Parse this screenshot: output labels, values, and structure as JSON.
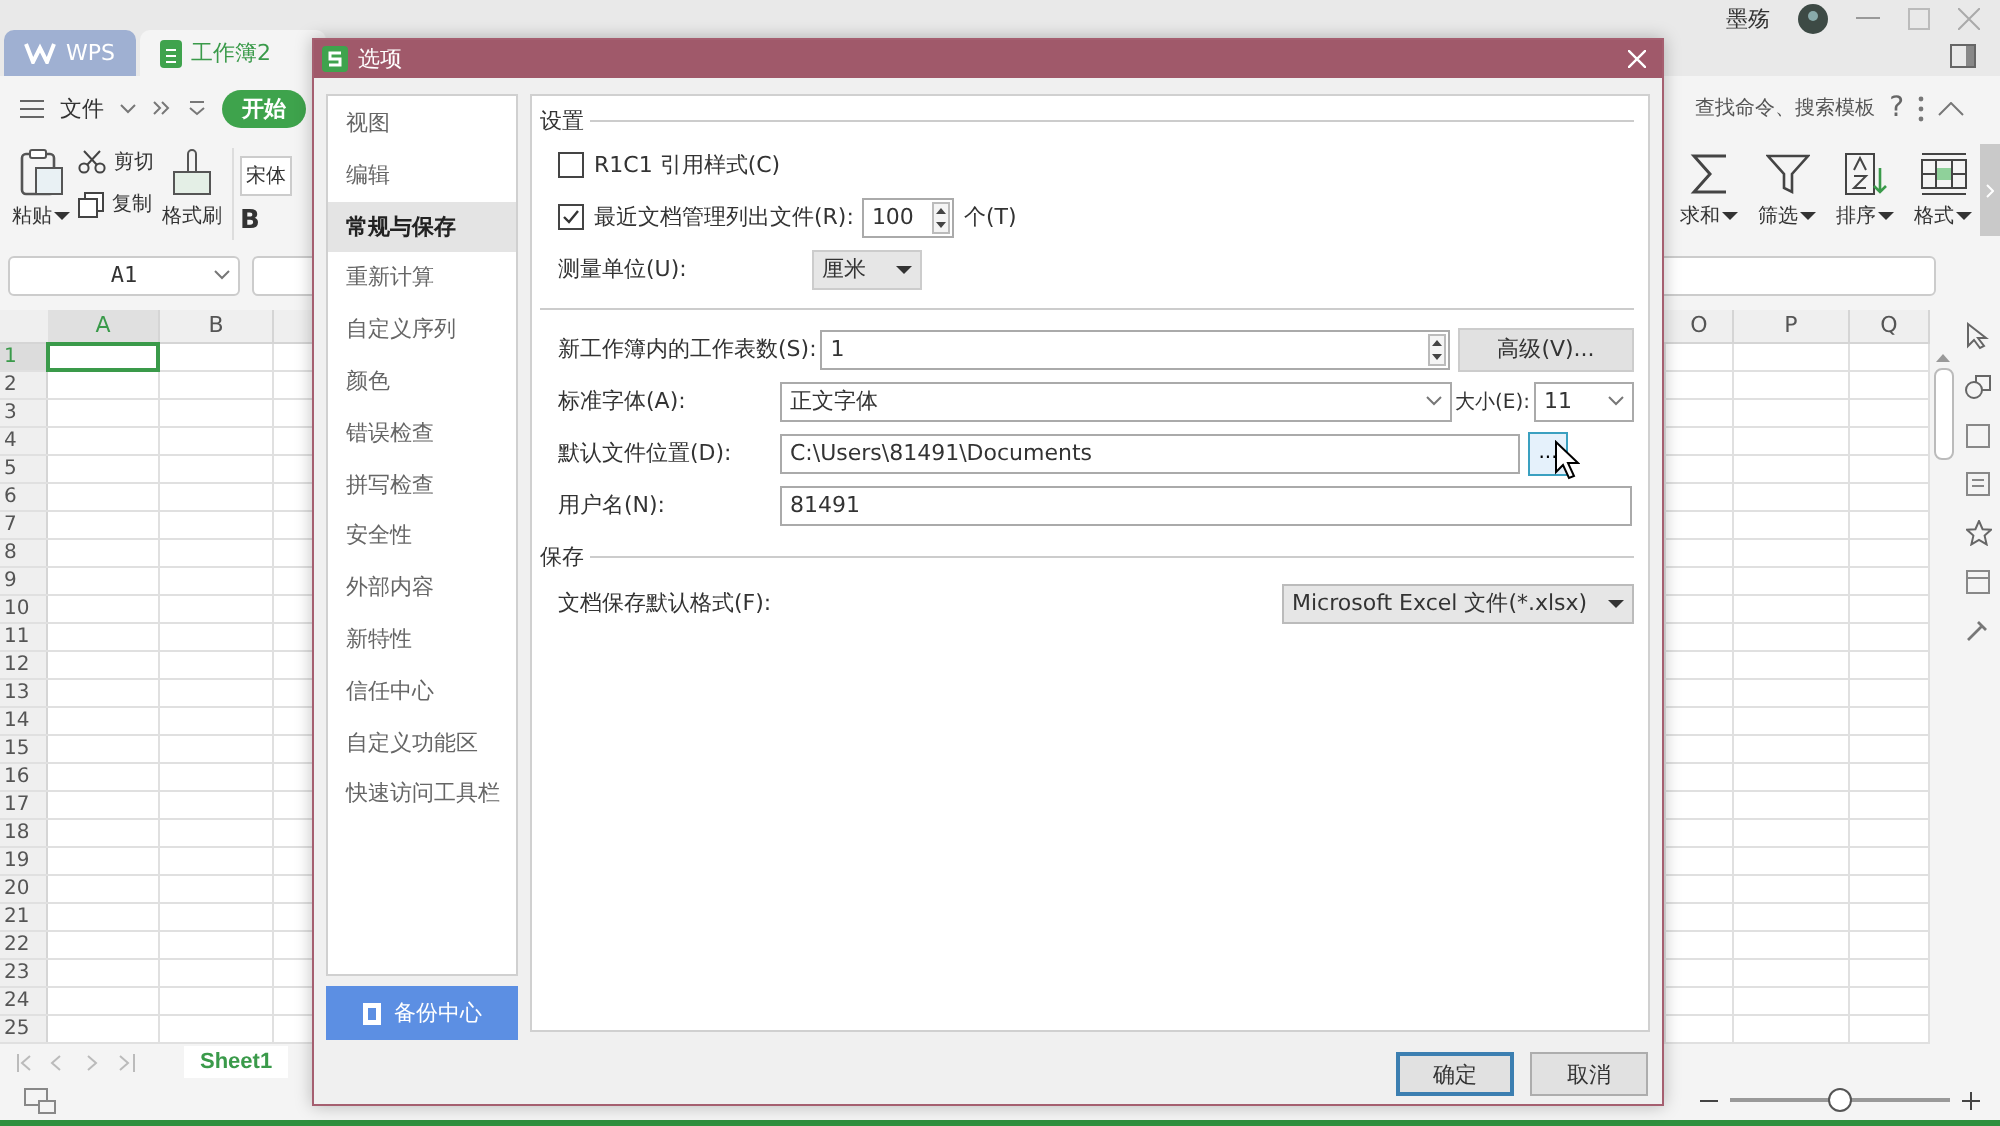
{
  "title_bar": {
    "tabs": [
      {
        "label": "WPS",
        "kind": "home",
        "selected": false
      },
      {
        "label": "工作簿2",
        "kind": "spreadsheet",
        "selected": true
      }
    ],
    "user_name": "墨殇"
  },
  "menu_bar": {
    "file": "文件",
    "tabs": [
      {
        "label": "开始",
        "selected": true
      }
    ],
    "search": "查找命令、搜索模板",
    "help": "?"
  },
  "ribbon": {
    "left": [
      {
        "label": "粘贴",
        "kind": "paste"
      },
      {
        "label": "剪切",
        "kind": "cut"
      },
      {
        "label": "复制",
        "kind": "copy"
      },
      {
        "label": "格式刷",
        "kind": "painter"
      }
    ],
    "font": "宋体",
    "bold": "B",
    "right": [
      {
        "label": "求和",
        "kind": "sum"
      },
      {
        "label": "筛选",
        "kind": "filter"
      },
      {
        "label": "排序",
        "kind": "sort"
      },
      {
        "label": "格式",
        "kind": "format"
      }
    ]
  },
  "name_box": "A1",
  "sheet": {
    "columns_left": [
      {
        "label": "A",
        "selected": true
      },
      {
        "label": "B",
        "selected": false
      }
    ],
    "columns_right": [
      {
        "label": "O",
        "selected": false
      },
      {
        "label": "P",
        "selected": false
      },
      {
        "label": "Q",
        "selected": false
      }
    ],
    "rows": [
      {
        "label": "1",
        "selected": true
      },
      {
        "label": "2",
        "selected": false
      },
      {
        "label": "3",
        "selected": false
      },
      {
        "label": "4",
        "selected": false
      },
      {
        "label": "5",
        "selected": false
      },
      {
        "label": "6",
        "selected": false
      },
      {
        "label": "7",
        "selected": false
      },
      {
        "label": "8",
        "selected": false
      },
      {
        "label": "9",
        "selected": false
      },
      {
        "label": "10",
        "selected": false
      },
      {
        "label": "11",
        "selected": false
      },
      {
        "label": "12",
        "selected": false
      },
      {
        "label": "13",
        "selected": false
      },
      {
        "label": "14",
        "selected": false
      },
      {
        "label": "15",
        "selected": false
      },
      {
        "label": "16",
        "selected": false
      },
      {
        "label": "17",
        "selected": false
      },
      {
        "label": "18",
        "selected": false
      },
      {
        "label": "19",
        "selected": false
      },
      {
        "label": "20",
        "selected": false
      },
      {
        "label": "21",
        "selected": false
      },
      {
        "label": "22",
        "selected": false
      },
      {
        "label": "23",
        "selected": false
      },
      {
        "label": "24",
        "selected": false
      },
      {
        "label": "25",
        "selected": false
      }
    ]
  },
  "sheet_tabs": [
    {
      "label": "Sheet1",
      "selected": true
    }
  ],
  "zoom": {
    "level": 0.5
  },
  "dialog": {
    "title": "选项",
    "nav": [
      {
        "label": "视图",
        "selected": false
      },
      {
        "label": "编辑",
        "selected": false
      },
      {
        "label": "常规与保存",
        "selected": true
      },
      {
        "label": "重新计算",
        "selected": false
      },
      {
        "label": "自定义序列",
        "selected": false
      },
      {
        "label": "颜色",
        "selected": false
      },
      {
        "label": "错误检查",
        "selected": false
      },
      {
        "label": "拼写检查",
        "selected": false
      },
      {
        "label": "安全性",
        "selected": false
      },
      {
        "label": "外部内容",
        "selected": false
      },
      {
        "label": "新特性",
        "selected": false
      },
      {
        "label": "信任中心",
        "selected": false
      },
      {
        "label": "自定义功能区",
        "selected": false
      },
      {
        "label": "快速访问工具栏",
        "selected": false
      }
    ],
    "backup_button": "备份中心",
    "settings": {
      "title": "设置",
      "r1c1": {
        "label": "R1C1 引用样式(C)",
        "checked": false
      },
      "recent": {
        "label": "最近文档管理列出文件(R):",
        "checked": true,
        "value": "100",
        "unit": "个(T)"
      },
      "unit": {
        "label": "测量单位(U):",
        "value": "厘米"
      },
      "sheet_count": {
        "label": "新工作簿内的工作表数(S):",
        "value": "1"
      },
      "advanced_button": "高级(V)...",
      "font": {
        "label": "标准字体(A):",
        "value": "正文字体"
      },
      "size": {
        "label": "大小(E):",
        "value": "11"
      },
      "location": {
        "label": "默认文件位置(D):",
        "value": "C:\\Users\\81491\\Documents",
        "browse": "..."
      },
      "user": {
        "label": "用户名(N):",
        "value": "81491"
      }
    },
    "save": {
      "title": "保存",
      "format": {
        "label": "文档保存默认格式(F):",
        "value": "Microsoft Excel 文件(*.xlsx)"
      }
    },
    "buttons": [
      {
        "label": "确定",
        "kind": "primary"
      },
      {
        "label": "取消",
        "kind": "normal"
      }
    ]
  }
}
